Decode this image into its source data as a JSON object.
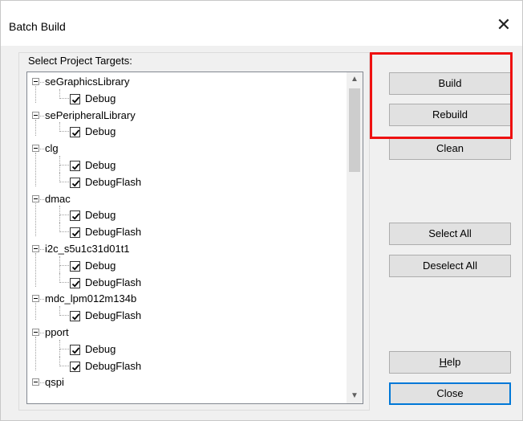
{
  "window": {
    "title": "Batch Build",
    "close_glyph": "✕"
  },
  "targets_label": "Select Project Targets:",
  "tree": [
    {
      "name": "seGraphicsLibrary",
      "configs": [
        "Debug"
      ]
    },
    {
      "name": "sePeripheralLibrary",
      "configs": [
        "Debug"
      ]
    },
    {
      "name": "clg",
      "configs": [
        "Debug",
        "DebugFlash"
      ]
    },
    {
      "name": "dmac",
      "configs": [
        "Debug",
        "DebugFlash"
      ]
    },
    {
      "name": "i2c_s5u1c31d01t1",
      "configs": [
        "Debug",
        "DebugFlash"
      ]
    },
    {
      "name": "mdc_lpm012m134b",
      "configs": [
        "DebugFlash"
      ]
    },
    {
      "name": "pport",
      "configs": [
        "Debug",
        "DebugFlash"
      ]
    },
    {
      "name": "qspi",
      "configs": []
    }
  ],
  "buttons": {
    "build": "Build",
    "rebuild": "Rebuild",
    "clean": "Clean",
    "select_all": "Select All",
    "deselect_all": "Deselect All",
    "help_mnemonic": "H",
    "help_rest": "elp",
    "close": "Close"
  },
  "colors": {
    "highlight": "#ee1111",
    "default_button_border": "#0078d7"
  },
  "icons": {
    "scroll_up": "▲",
    "scroll_down": "▼"
  }
}
